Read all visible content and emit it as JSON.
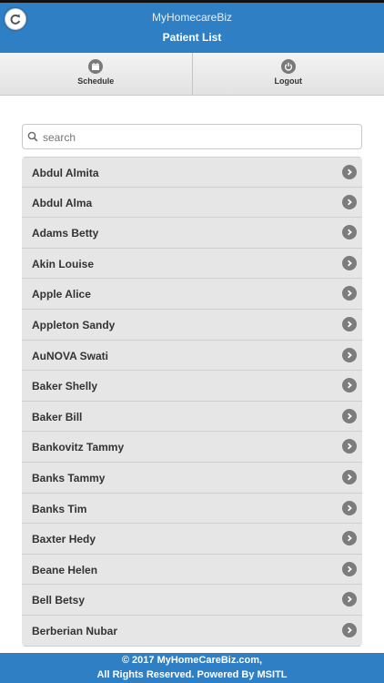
{
  "header": {
    "app_title": "MyHomecareBiz",
    "page_title": "Patient List",
    "back_icon": "back-arrow-icon"
  },
  "nav": {
    "schedule_label": "Schedule",
    "schedule_icon": "calendar-icon",
    "logout_label": "Logout",
    "logout_icon": "power-icon"
  },
  "search": {
    "placeholder": "search",
    "value": ""
  },
  "patients": [
    "Abdul Almita",
    "Abdul Alma",
    "Adams Betty",
    "Akin Louise",
    "Apple Alice",
    "Appleton Sandy",
    "AuNOVA Swati",
    "Baker Shelly",
    "Baker Bill",
    "Bankovitz Tammy",
    "Banks Tammy",
    "Banks Tim",
    "Baxter Hedy",
    "Beane Helen",
    "Bell Betsy",
    "Berberian Nubar"
  ],
  "footer": {
    "line1": "© 2017 MyHomeCareBiz.com,",
    "line2": "All Rights Reserved. Powered By MSITL"
  },
  "colors": {
    "brand_blue": "#2f7fc4",
    "row_bg": "#e6e6e6",
    "icon_gray": "#7c7c7c"
  }
}
